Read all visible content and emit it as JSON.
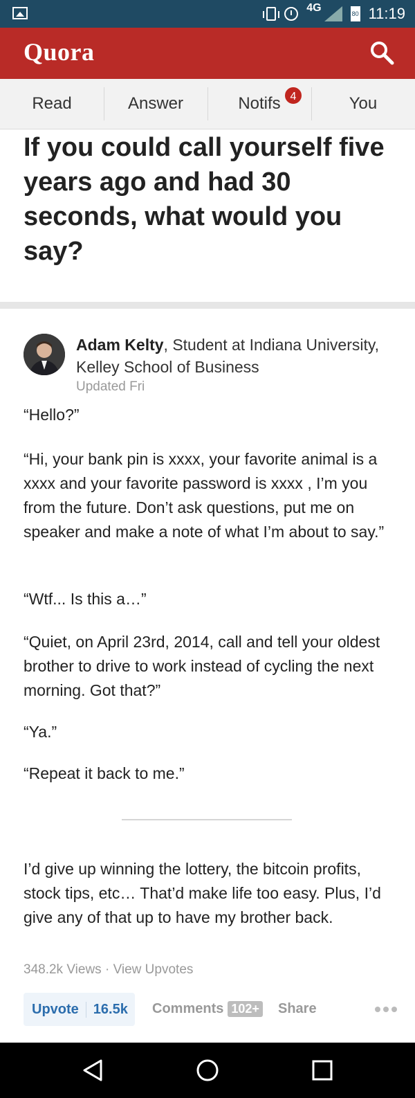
{
  "status_bar": {
    "network": "4G",
    "battery": "80",
    "time": "11:19"
  },
  "app": {
    "name": "Quora"
  },
  "tabs": [
    {
      "label": "Read"
    },
    {
      "label": "Answer"
    },
    {
      "label": "Notifs",
      "badge": "4"
    },
    {
      "label": "You"
    }
  ],
  "question": {
    "title": "If you could call yourself five years ago and had 30 seconds, what would you say?"
  },
  "answer": {
    "author": "Adam Kelty",
    "credential": ", Student at Indiana University, Kelley School of Business",
    "updated": "Updated Fri",
    "paragraphs": [
      "“Hello?”",
      "“Hi, your bank pin is xxxx, your favorite animal is a xxxx and your favorite password is xxxx , I’m you from the future. Don’t ask questions, put me on speaker and make a note of what I’m about to say.”",
      "“Wtf... Is this a…”",
      "“Quiet, on April 23rd, 2014, call and tell your oldest brother to drive to work instead of cycling the next morning. Got that?”",
      "“Ya.”",
      "“Repeat it back to me.”",
      "I’d give up winning the lottery, the bitcoin profits, stock tips, etc… That’d make life too easy. Plus, I’d give any of that up to have my brother back."
    ],
    "views": "348.2k Views",
    "separator": " · ",
    "view_upvotes": "View Upvotes"
  },
  "actions": {
    "upvote_label": "Upvote",
    "upvote_count": "16.5k",
    "comments_label": "Comments",
    "comments_count": "102+",
    "share_label": "Share"
  },
  "colors": {
    "brand": "#b92b27",
    "status_bar": "#1f4a63",
    "upvote": "#2b6dad"
  },
  "icons": [
    "image-icon",
    "vibrate-icon",
    "alarm-icon",
    "signal-icon",
    "battery-icon",
    "search-icon",
    "more-icon",
    "back-icon",
    "home-icon",
    "recents-icon"
  ]
}
